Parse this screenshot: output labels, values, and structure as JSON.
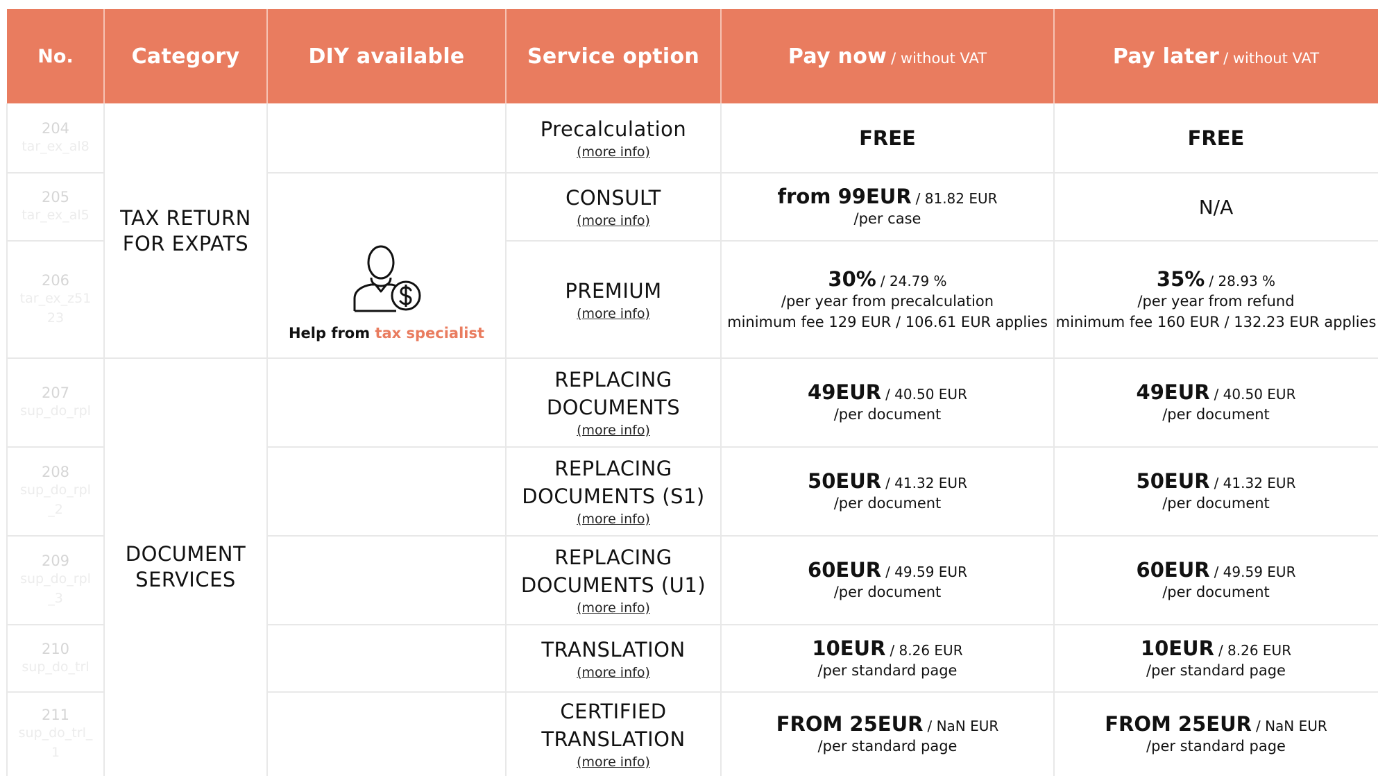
{
  "header": {
    "no": "No.",
    "category": "Category",
    "diy": "DIY available",
    "service_option": "Service option",
    "pay_now": "Pay now",
    "pay_now_sub": "/ without VAT",
    "pay_later": "Pay later",
    "pay_later_sub": "/ without VAT"
  },
  "colors": {
    "accent": "#e97c5f",
    "grid": "#e8e8e8"
  },
  "categories": [
    "TAX RETURN FOR EXPATS",
    "DOCUMENT SERVICES"
  ],
  "diy": {
    "icon": "tax-specialist-icon",
    "caption_prefix": "Help from ",
    "caption_highlight": "tax specialist"
  },
  "more_info": "(more info)",
  "rows": [
    {
      "no": "204",
      "code": "tar_ex_al8",
      "service": "Precalculation",
      "now_free": "FREE",
      "later_free": "FREE"
    },
    {
      "no": "205",
      "code": "tar_ex_al5",
      "service": "CONSULT",
      "now_main": "from 99EUR",
      "now_net": "/ 81.82 EUR",
      "now_unit": "/per case",
      "later_na": "N/A"
    },
    {
      "no": "206",
      "code": "tar_ex_z5123",
      "service": "PREMIUM",
      "now_main": "30%",
      "now_net": "/ 24.79 %",
      "now_unit": "/per year from precalculation",
      "now_unit2": "minimum fee 129 EUR / 106.61 EUR applies",
      "later_main": "35%",
      "later_net": "/ 28.93 %",
      "later_unit": "/per year from refund",
      "later_unit2": "minimum fee 160 EUR / 132.23 EUR applies"
    },
    {
      "no": "207",
      "code": "sup_do_rpl",
      "service": "REPLACING DOCUMENTS",
      "now_main": "49EUR",
      "now_net": "/ 40.50 EUR",
      "now_unit": "/per document",
      "later_main": "49EUR",
      "later_net": "/ 40.50 EUR",
      "later_unit": "/per document"
    },
    {
      "no": "208",
      "code": "sup_do_rpl_2",
      "service": "REPLACING DOCUMENTS (S1)",
      "now_main": "50EUR",
      "now_net": "/ 41.32 EUR",
      "now_unit": "/per document",
      "later_main": "50EUR",
      "later_net": "/ 41.32 EUR",
      "later_unit": "/per document"
    },
    {
      "no": "209",
      "code": "sup_do_rpl_3",
      "service": "REPLACING DOCUMENTS (U1)",
      "now_main": "60EUR",
      "now_net": "/ 49.59 EUR",
      "now_unit": "/per document",
      "later_main": "60EUR",
      "later_net": "/ 49.59 EUR",
      "later_unit": "/per document"
    },
    {
      "no": "210",
      "code": "sup_do_trl",
      "service": "TRANSLATION",
      "now_main": "10EUR",
      "now_net": "/ 8.26 EUR",
      "now_unit": "/per standard page",
      "later_main": "10EUR",
      "later_net": "/ 8.26 EUR",
      "later_unit": "/per standard page"
    },
    {
      "no": "211",
      "code": "sup_do_trl_1",
      "service": "CERTIFIED TRANSLATION",
      "now_main": "FROM 25EUR",
      "now_net": "/ NaN EUR",
      "now_unit": "/per standard page",
      "later_main": "FROM 25EUR",
      "later_net": "/ NaN EUR",
      "later_unit": "/per standard page"
    }
  ]
}
